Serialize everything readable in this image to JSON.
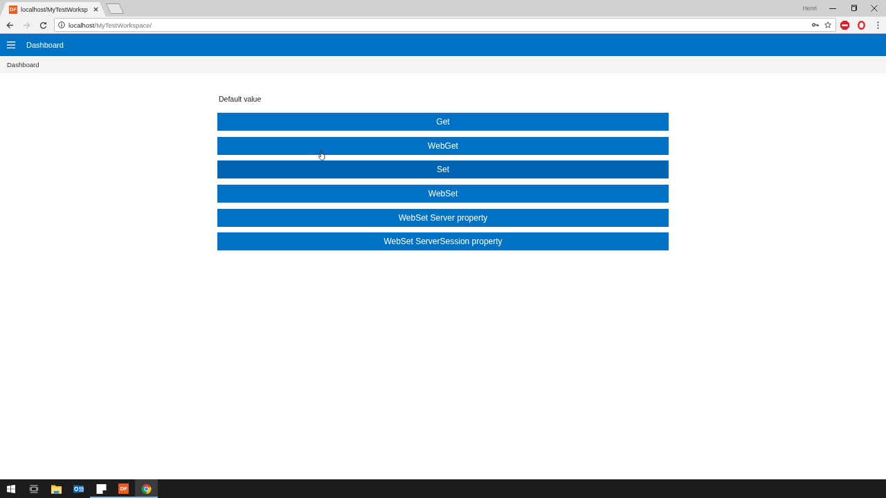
{
  "browser": {
    "tabs": [
      {
        "favicon": "DF",
        "title": "localhost/MyTestWorksp",
        "selected": true
      }
    ],
    "profile": "Henri",
    "nav_buttons": [
      {
        "kind": "back",
        "disabled": false
      },
      {
        "kind": "forward",
        "disabled": true
      },
      {
        "kind": "reload",
        "disabled": false
      }
    ],
    "address": {
      "host": "localhost",
      "path": "/MyTestWorkspace/"
    }
  },
  "app_bar": {
    "title": "Dashboard"
  },
  "breadcrumb": "Dashboard",
  "content": {
    "label": "Default value",
    "buttons": [
      {
        "label": "Get",
        "focused": false
      },
      {
        "label": "WebGet",
        "focused": false
      },
      {
        "label": "Set",
        "focused": true
      },
      {
        "label": "WebSet",
        "focused": false
      },
      {
        "label": "WebSet Server property",
        "focused": false
      },
      {
        "label": "WebSet ServerSession property",
        "focused": false
      }
    ]
  },
  "taskbar": {
    "apps": [
      {
        "kind": "folder",
        "running": false,
        "selected": false
      },
      {
        "kind": "mail",
        "running": false,
        "selected": false
      },
      {
        "kind": "note",
        "running": true,
        "selected": false
      },
      {
        "kind": "tile",
        "text": "DF",
        "running": true,
        "selected": false
      },
      {
        "kind": "circle",
        "running": true,
        "selected": true
      }
    ]
  }
}
